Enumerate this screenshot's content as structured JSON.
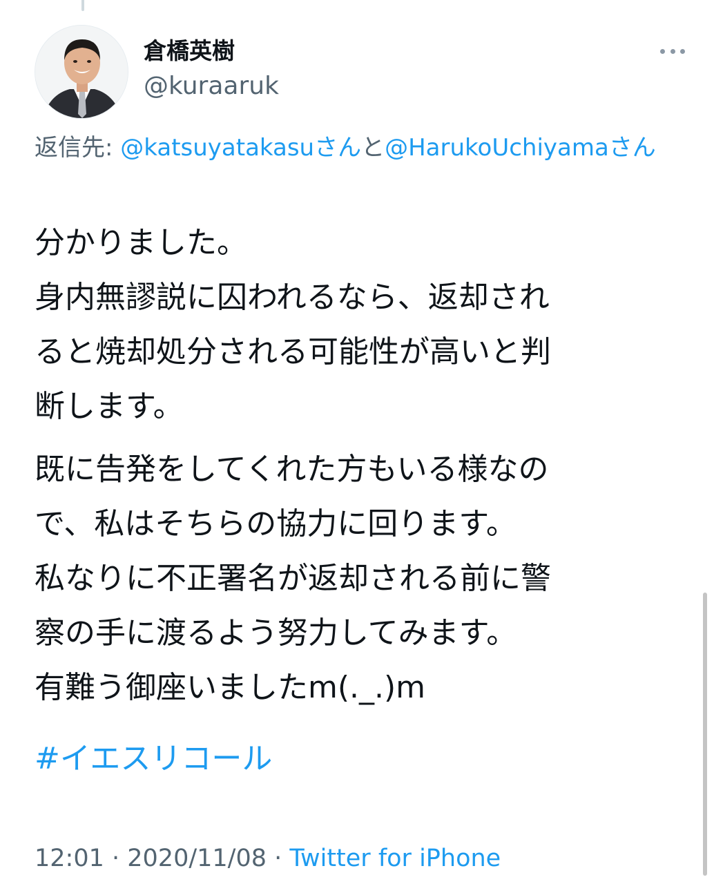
{
  "author": {
    "display_name": "倉橋英樹",
    "handle": "@kuraaruk"
  },
  "reply": {
    "prefix": "返信先: ",
    "mention1": "@katsuyatakasu",
    "san1": "さん",
    "joiner": "と",
    "mention2": "@HarukoUchiyama",
    "san2": "さん"
  },
  "body": {
    "p1_lines": [
      "分かりました。",
      "身内無謬説に囚われるなら、返却され",
      "ると焼却処分される可能性が高いと判",
      "断します。"
    ],
    "p2_lines": [
      "既に告発をしてくれた方もいる様なの",
      "で、私はそちらの協力に回ります。",
      "私なりに不正署名が返却される前に警",
      "察の手に渡るよう努力してみます。",
      "有難う御座いましたm(._.)m"
    ],
    "hashtag": "#イエスリコール"
  },
  "meta": {
    "time": "12:01",
    "separator": " · ",
    "date": "2020/11/08",
    "source": "Twitter for iPhone"
  },
  "icons": {
    "more": "more-dots-icon",
    "avatar": "profile-photo"
  },
  "colors": {
    "link": "#1d9bf0",
    "secondary_text": "#536471",
    "primary_text": "#0f1419"
  }
}
